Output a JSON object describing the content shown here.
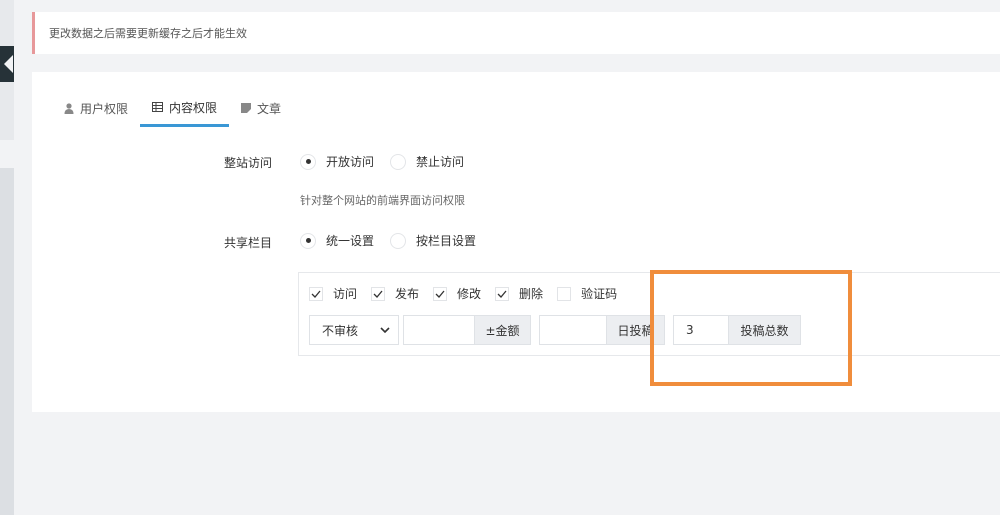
{
  "notice": {
    "text": "更改数据之后需要更新缓存之后才能生效"
  },
  "tabs": [
    {
      "label": "用户权限",
      "icon": "user-icon",
      "active": false
    },
    {
      "label": "内容权限",
      "icon": "table-icon",
      "active": true
    },
    {
      "label": "文章",
      "icon": "article-icon",
      "active": false
    }
  ],
  "site_access": {
    "label": "整站访问",
    "options": [
      {
        "label": "开放访问",
        "checked": true
      },
      {
        "label": "禁止访问",
        "checked": false
      }
    ],
    "hint": "针对整个网站的前端界面访问权限"
  },
  "shared_column": {
    "label": "共享栏目",
    "options": [
      {
        "label": "统一设置",
        "checked": true
      },
      {
        "label": "按栏目设置",
        "checked": false
      }
    ]
  },
  "permissions": {
    "checks": [
      {
        "label": "访问",
        "checked": true
      },
      {
        "label": "发布",
        "checked": true
      },
      {
        "label": "修改",
        "checked": true
      },
      {
        "label": "删除",
        "checked": true
      },
      {
        "label": "验证码",
        "checked": false
      }
    ],
    "review_select": {
      "value": "不审核"
    },
    "amount": {
      "value": "",
      "addon": "±金额"
    },
    "daily_post": {
      "value": "",
      "addon": "日投稿"
    },
    "total_post": {
      "value": "3",
      "addon": "投稿总数"
    }
  },
  "colors": {
    "accent": "#3a97d5",
    "highlight": "#f08d3c",
    "notice_border": "#e7989a"
  }
}
